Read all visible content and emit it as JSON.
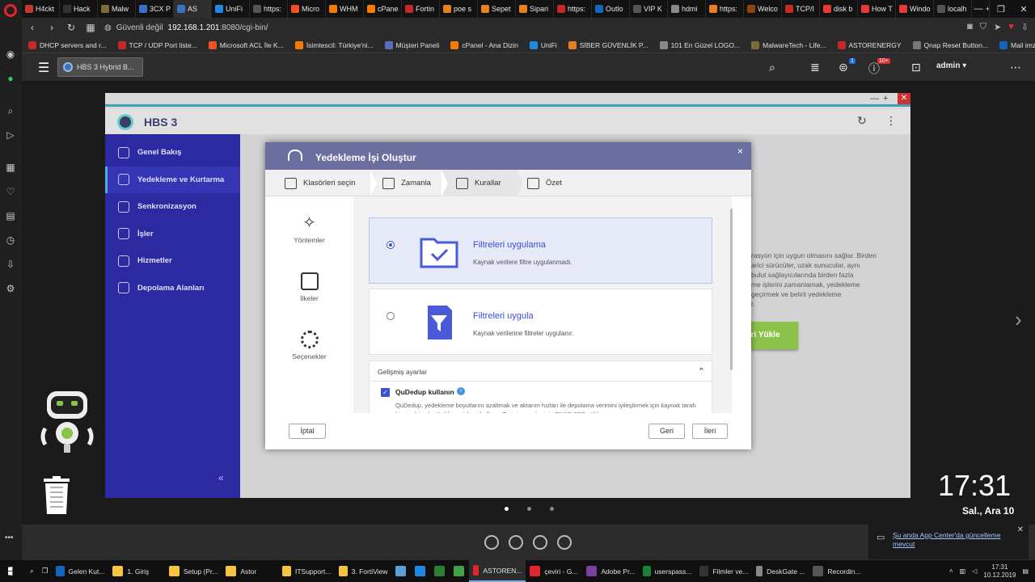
{
  "browser": {
    "tabs": [
      {
        "label": "H4ckt",
        "color": "#c0392b"
      },
      {
        "label": "Hack",
        "color": "#333333"
      },
      {
        "label": "Malw",
        "color": "#7d6b3a"
      },
      {
        "label": "3CX P",
        "color": "#3b6fc4"
      },
      {
        "label": "AS",
        "color": "#3b6fc4",
        "active": true
      },
      {
        "label": "UniFi",
        "color": "#1e88e5"
      },
      {
        "label": "https:",
        "color": "#555555"
      },
      {
        "label": "Micro",
        "color": "#f25022"
      },
      {
        "label": "WHM",
        "color": "#f57c00"
      },
      {
        "label": "cPane",
        "color": "#f57c00"
      },
      {
        "label": "Fortin",
        "color": "#c62828"
      },
      {
        "label": "poe s",
        "color": "#e67e22"
      },
      {
        "label": "Sepet",
        "color": "#e67e22"
      },
      {
        "label": "Sipari",
        "color": "#e67e22"
      },
      {
        "label": "https:",
        "color": "#c62828"
      },
      {
        "label": "Outlo",
        "color": "#1565c0"
      },
      {
        "label": "VIP K",
        "color": "#555555"
      },
      {
        "label": "hdmi",
        "color": "#888888"
      },
      {
        "label": "https:",
        "color": "#e67e22"
      },
      {
        "label": "Welco",
        "color": "#8b4513"
      },
      {
        "label": "TCP/I",
        "color": "#c62828"
      },
      {
        "label": "disk b",
        "color": "#e53935"
      },
      {
        "label": "How T",
        "color": "#e53935"
      },
      {
        "label": "Windo",
        "color": "#e53935"
      },
      {
        "label": "localh",
        "color": "#555555"
      },
      {
        "label": "+",
        "color": "#121212"
      }
    ],
    "address": {
      "security": "Güvenli değil",
      "url": "192.168.1.201",
      "url_rest": ":8080/cgi-bin/"
    },
    "bookmarks": [
      {
        "label": "DHCP servers and r...",
        "color": "#c62828"
      },
      {
        "label": "TCP / UDP Port liste...",
        "color": "#c62828"
      },
      {
        "label": "Microsoft ACL İle K...",
        "color": "#f25022"
      },
      {
        "label": "İsimtescil: Türkiye'ni...",
        "color": "#f57c00"
      },
      {
        "label": "Müşteri Paneli",
        "color": "#5c6bc0"
      },
      {
        "label": "cPanel - Ana Dizin",
        "color": "#f57c00"
      },
      {
        "label": "UniFi",
        "color": "#1e88e5"
      },
      {
        "label": "SİBER GÜVENLİK P...",
        "color": "#e67e22"
      },
      {
        "label": "101 En Güzel LOGO...",
        "color": "#888888"
      },
      {
        "label": "MalwareTech - Life...",
        "color": "#7d6b3a"
      },
      {
        "label": "ASTORENERGY",
        "color": "#c62828"
      },
      {
        "label": "Qnap Reset Button...",
        "color": "#777777"
      },
      {
        "label": "Mail imza tasarımla...",
        "color": "#1565c0"
      }
    ]
  },
  "qts": {
    "app_tab": "HBS 3 Hybrid B...",
    "badges": {
      "tasks": "1",
      "notifications": "10+"
    },
    "user": "admin ▾"
  },
  "hbs": {
    "title": "HBS 3",
    "nav": [
      {
        "label": "Genel Bakış"
      },
      {
        "label": "Yedekleme ve Kurtarma",
        "active": true
      },
      {
        "label": "Senkronizasyon"
      },
      {
        "label": "İşler"
      },
      {
        "label": "Hizmetler"
      },
      {
        "label": "Depolama Alanları"
      }
    ],
    "collapse": "«",
    "bg_lines": [
      "rasyon için uygun olmasını sağlar. Birden",
      "arici sürücüler, uzak sunucular, aynı",
      "bulut sağlayıcılarında birden fazla",
      "me işlerini zamanlamak, yedekleme",
      " geçirmek ve belirli yedekleme",
      "r."
    ],
    "bg_button": "eri Yükle"
  },
  "dialog": {
    "title": "Yedekleme İşi Oluştur",
    "close": "×",
    "steps": [
      {
        "label": "Klasörleri seçin"
      },
      {
        "label": "Zamanla"
      },
      {
        "label": "Kurallar"
      },
      {
        "label": "Özet"
      }
    ],
    "rail": [
      {
        "label": "Yöntemler"
      },
      {
        "label": "İlkeler"
      },
      {
        "label": "Seçenekler"
      }
    ],
    "options": [
      {
        "title": "Filtreleri uygulama",
        "desc": "Kaynak verilere filtre uygulanmadı.",
        "selected": true
      },
      {
        "title": "Filtreleri uygula",
        "desc": "Kaynak verilerine filtreler uygulanır.",
        "selected": false
      }
    ],
    "advanced": {
      "title": "Gelişmiş ayarlar",
      "qudedup_label": "QuDedup kullanın",
      "qudedup_checked": true,
      "qudedup_desc": "QuDedup, yedekleme boyutlarını azaltmak ve aktarım hızları ile depolama verimini iyileştirmek için kaynak tarafı bir yinelemeleri kaldırma işlemi kullanır. En iyi sonuçlar için QNAP SSD yükl"
    },
    "buttons": {
      "cancel": "İptal",
      "back": "Geri",
      "next": "İleri"
    }
  },
  "desktop": {
    "clock": "17:31",
    "date": "Sal., Ara 10",
    "notification": "Şu anda App Center'da güncelleme mevcut",
    "pager_dots": 3,
    "pager_active": 0
  },
  "taskbar": {
    "items": [
      {
        "label": "Gelen Kut...",
        "color": "#1565c0"
      },
      {
        "label": "1. Giriş",
        "color": "#f5c542"
      },
      {
        "label": "Setup (Pr...",
        "color": "#f5c542"
      },
      {
        "label": "Astor",
        "color": "#f5c542"
      },
      {
        "label": "ITSupport...",
        "color": "#f5c542"
      },
      {
        "label": "3. FortiView",
        "color": "#f5c542"
      },
      {
        "label": "",
        "color": "#5aa0d8"
      },
      {
        "label": "",
        "color": "#1e88e5"
      },
      {
        "label": "",
        "color": "#2e7d32"
      },
      {
        "label": "",
        "color": "#43a047"
      },
      {
        "label": "ASTOREN...",
        "color": "#e0252f",
        "active": true
      },
      {
        "label": "çeviri - G...",
        "color": "#e0252f"
      },
      {
        "label": "Adobe Pr...",
        "color": "#7b3fa0"
      },
      {
        "label": "userspass...",
        "color": "#1e7e3a"
      },
      {
        "label": "Filmler ve...",
        "color": "#333333"
      },
      {
        "label": "DeskGate ...",
        "color": "#888888"
      },
      {
        "label": "Recordin...",
        "color": "#555555"
      }
    ],
    "tray_time": "17:31",
    "tray_date": "10.12.2019"
  }
}
